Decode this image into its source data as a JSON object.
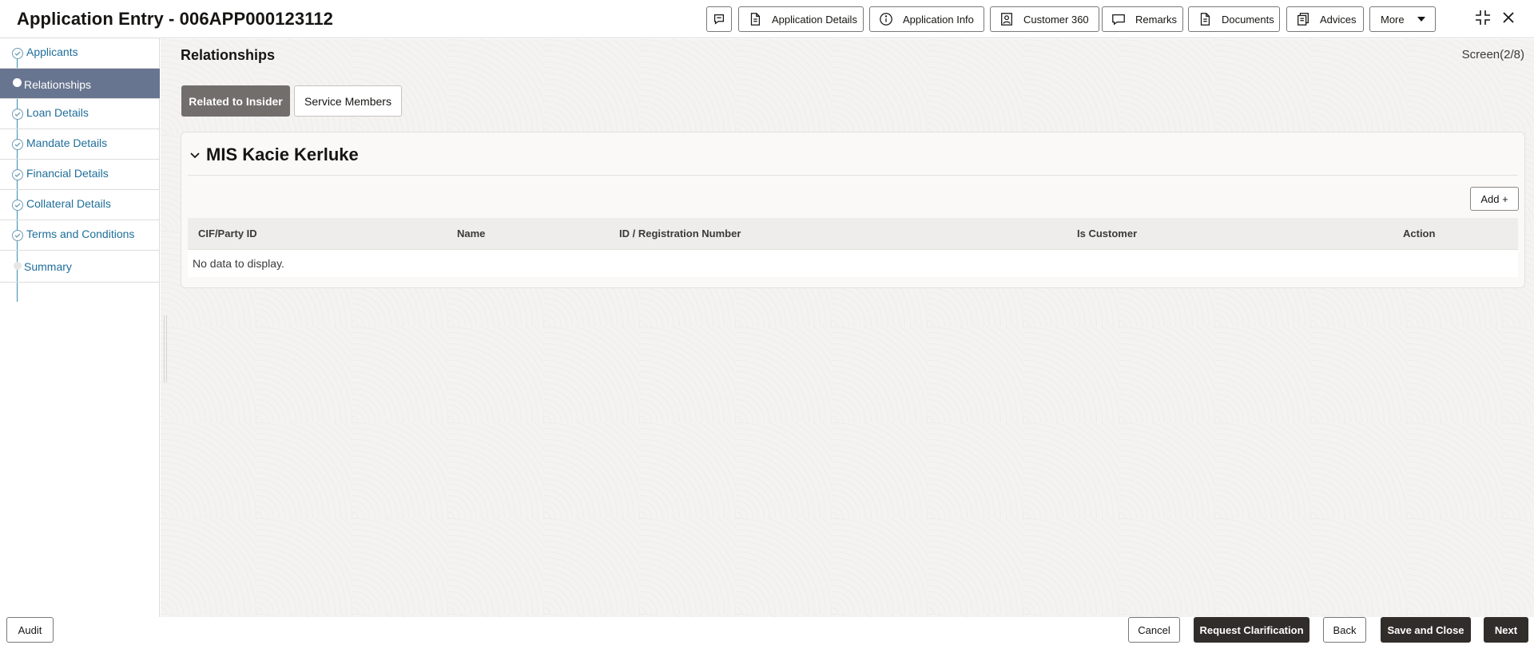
{
  "header": {
    "title": "Application Entry - 006APP000123112",
    "buttons": {
      "chat": "",
      "application_details": "Application Details",
      "application_info": "Application Info",
      "customer_360": "Customer 360",
      "remarks": "Remarks",
      "documents": "Documents",
      "advices": "Advices",
      "more": "More"
    },
    "icons": [
      "chat-bubble-icon",
      "document-icon",
      "info-icon",
      "person-icon",
      "comment-icon",
      "documents-icon",
      "advices-icon",
      "caret-down-icon",
      "collapse-icon",
      "close-icon"
    ]
  },
  "sidebar": {
    "steps": [
      {
        "label": "Applicants",
        "state": "completed"
      },
      {
        "label": "Relationships",
        "state": "active"
      },
      {
        "label": "Loan Details",
        "state": "completed"
      },
      {
        "label": "Mandate Details",
        "state": "completed"
      },
      {
        "label": "Financial Details",
        "state": "completed"
      },
      {
        "label": "Collateral Details",
        "state": "completed"
      },
      {
        "label": "Terms and Conditions",
        "state": "completed"
      },
      {
        "label": "Summary",
        "state": "pending"
      }
    ]
  },
  "main": {
    "title": "Relationships",
    "screen_counter": "Screen(2/8)",
    "tabs": [
      {
        "label": "Related to Insider",
        "selected": true
      },
      {
        "label": "Service Members",
        "selected": false
      }
    ],
    "panel": {
      "title": "MIS Kacie Kerluke",
      "add_label": "Add +",
      "columns": [
        "CIF/Party ID",
        "Name",
        "ID / Registration Number",
        "Is Customer",
        "Action"
      ],
      "empty_text": "No data to display."
    }
  },
  "footer": {
    "audit": "Audit",
    "cancel": "Cancel",
    "request_clarification": "Request Clarification",
    "back": "Back",
    "save_and_close": "Save and Close",
    "next": "Next"
  },
  "colors": {
    "active_step_bg": "#687590",
    "link_blue": "#1f6e9a",
    "primary_button": "#312d2a",
    "selected_tab": "#716e6b"
  }
}
